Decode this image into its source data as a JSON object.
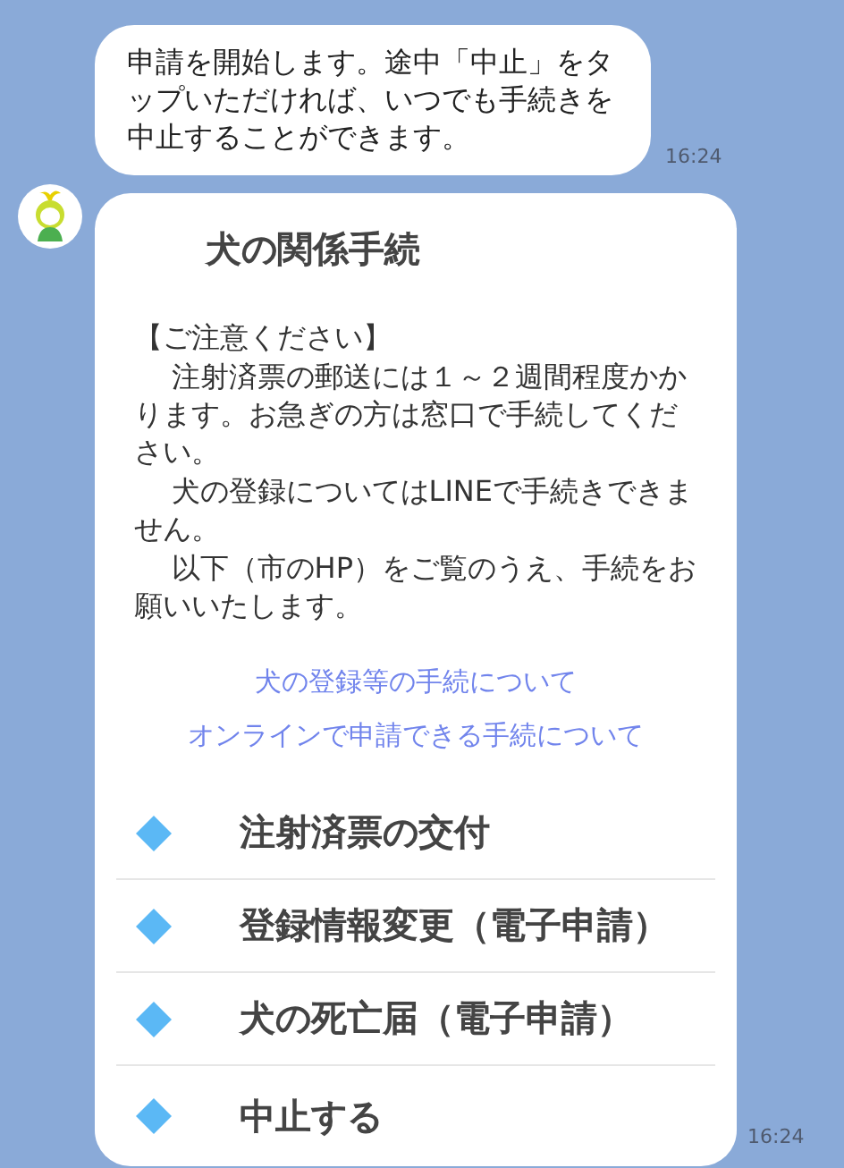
{
  "messages": [
    {
      "kind": "text",
      "text": "申請を開始します。途中「中止」をタップいただければ、いつでも手続きを中止することができます。",
      "time": "16:24"
    },
    {
      "kind": "card",
      "title": "犬の関係手続",
      "notice_heading": "【ご注意ください】",
      "notice_paragraphs": [
        "注射済票の郵送には１～２週間程度かかります。お急ぎの方は窓口で手続してください。",
        "犬の登録についてはLINEで手続きできません。",
        "以下（市のHP）をご覧のうえ、手続をお願いいたします。"
      ],
      "links": [
        "犬の登録等の手続について",
        "オンラインで申請できる手続について"
      ],
      "menu": [
        "注射済票の交付",
        "登録情報変更（電子申請）",
        "犬の死亡届（電子申請）",
        "中止する"
      ],
      "time": "16:24"
    }
  ]
}
